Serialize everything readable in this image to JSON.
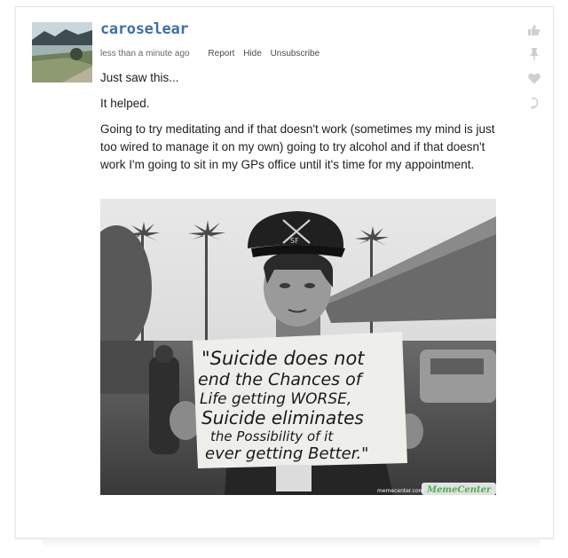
{
  "post": {
    "username": "caroselear",
    "timestamp": "less than a minute ago",
    "actions": [
      "Report",
      "Hide",
      "Unsubscribe"
    ],
    "paragraphs": [
      "Just saw this...",
      "It helped.",
      "Going to try meditating and if that doesn't work (sometimes my mind is just too wired to manage it on my own) going to try alcohol and if that doesn't work I'm going to sit in my GPs office until it's time for my appointment."
    ],
    "image": {
      "sign_lines": [
        "\"Suicide does not",
        "end the Chances of",
        "Life getting WORSE,",
        "Suicide eliminates",
        "the Possibility of it",
        "ever getting Better.\""
      ],
      "hat_text": "SF",
      "watermark_small": "memecenter.com",
      "watermark_brand": "MemeCenter"
    }
  },
  "sidebar_icons": [
    "thumbs-up-icon",
    "pin-icon",
    "heart-icon",
    "reply-icon"
  ],
  "colors": {
    "username": "#3d6fa8",
    "icon_gray": "#cfcfcf",
    "brand_green": "#4caf50"
  }
}
